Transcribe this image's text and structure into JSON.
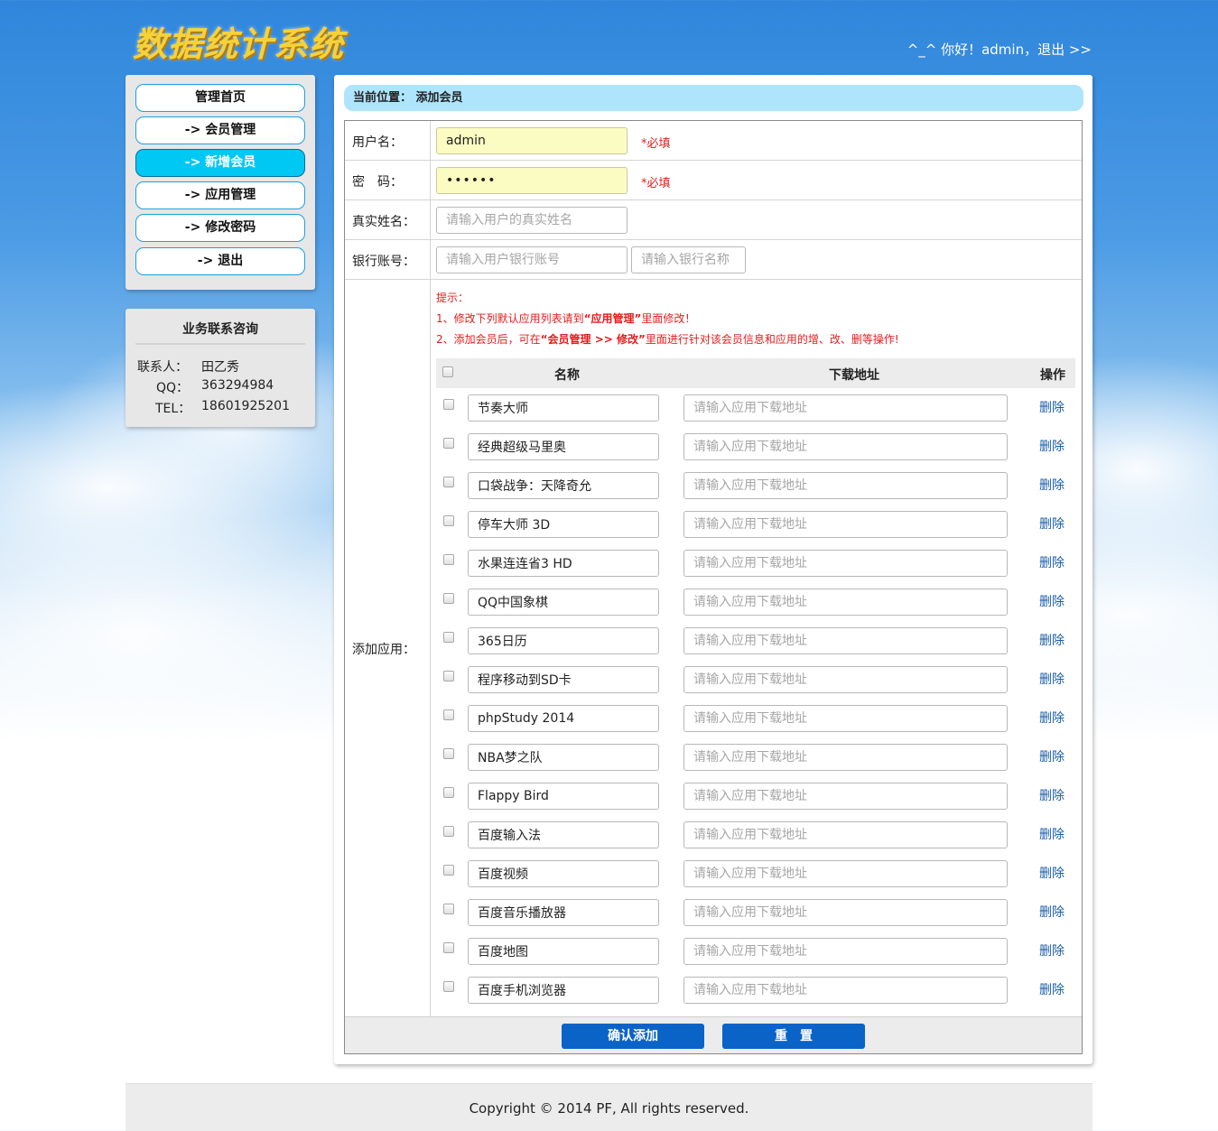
{
  "header": {
    "logo_text": "数据统计系统",
    "greeting_prefix": "^_^ 你好！admin，",
    "logout_link": "退出 >>"
  },
  "nav": {
    "items": [
      {
        "label": "管理首页",
        "active": false
      },
      {
        "label": "-> 会员管理",
        "active": false
      },
      {
        "label": "-> 新增会员",
        "active": true
      },
      {
        "label": "-> 应用管理",
        "active": false
      },
      {
        "label": "-> 修改密码",
        "active": false
      },
      {
        "label": "-> 退出",
        "active": false
      }
    ]
  },
  "contact": {
    "title": "业务联系咨询",
    "person_label": "联系人：",
    "person_value": "田乙秀",
    "qq_label": "QQ：",
    "qq_value": "363294984",
    "tel_label": "TEL：",
    "tel_value": "18601925201"
  },
  "breadcrumb": "当前位置： 添加会员",
  "form": {
    "username_label": "用户名：",
    "username_value": "admin",
    "password_label": "密　码：",
    "password_value": "••••••",
    "required_mark": "*必填",
    "realname_label": "真实姓名：",
    "realname_placeholder": "请输入用户的真实姓名",
    "bank_label": "银行账号：",
    "bank_account_placeholder": "请输入用户银行账号",
    "bank_name_placeholder": "请输入银行名称",
    "apps_label": "添加应用：",
    "tips_title": "提示：",
    "tip1_a": "1、修改下列默认应用列表请到",
    "tip1_b": "“应用管理”",
    "tip1_c": "里面修改！",
    "tip2_a": "2、添加会员后，可在",
    "tip2_b": "“会员管理 >> 修改”",
    "tip2_c": "里面进行针对该会员信息和应用的增、改、删等操作!",
    "col_name": "名称",
    "col_url": "下载地址",
    "col_op": "操作",
    "url_placeholder": "请输入应用下载地址",
    "delete_label": "删除",
    "submit_label": "确认添加",
    "reset_label": "重　置"
  },
  "apps": [
    "节奏大师",
    "经典超级马里奥",
    "口袋战争：天降奇允",
    "停车大师 3D",
    "水果连连省3 HD",
    "QQ中国象棋",
    "365日历",
    "程序移动到SD卡",
    "phpStudy 2014",
    "NBA梦之队",
    "Flappy Bird",
    "百度输入法",
    "百度视频",
    "百度音乐播放器",
    "百度地图",
    "百度手机浏览器"
  ],
  "footer": "Copyright © 2014 PF, All rights reserved.",
  "colors": {
    "nav_active": "#00c8f5",
    "button_blue": "#0a63c7",
    "required_red": "#e02020",
    "breadcrumb_bg": "#aee5fd"
  }
}
